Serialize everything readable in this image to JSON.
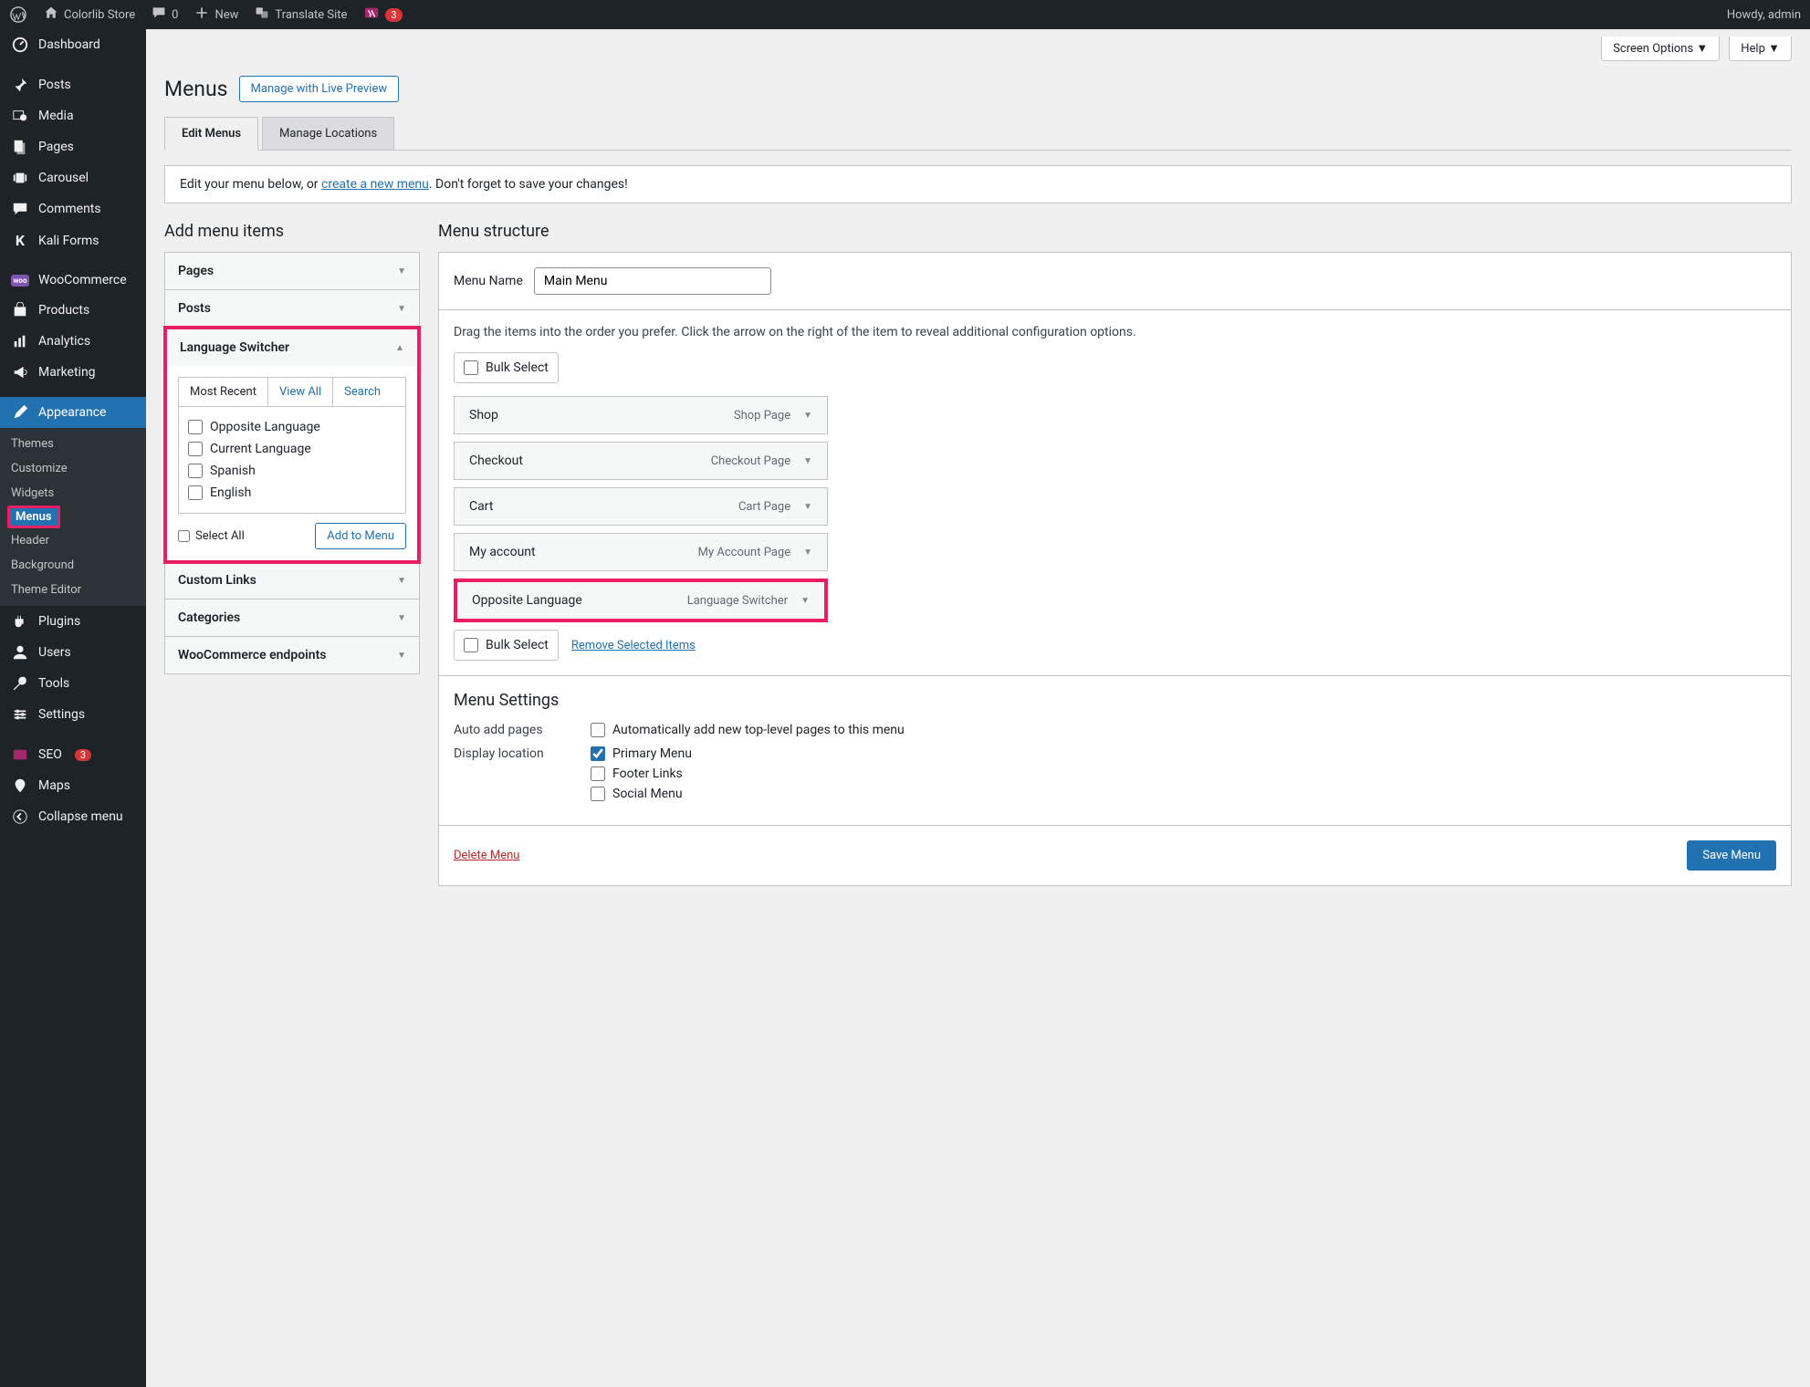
{
  "topbar": {
    "site_name": "Colorlib Store",
    "comments_count": "0",
    "new_label": "New",
    "translate_label": "Translate Site",
    "yoast_count": "3",
    "greeting": "Howdy, admin"
  },
  "sidebar": {
    "items": [
      {
        "label": "Dashboard",
        "icon": "dashboard"
      },
      {
        "label": "Posts",
        "icon": "pin"
      },
      {
        "label": "Media",
        "icon": "media"
      },
      {
        "label": "Pages",
        "icon": "pages"
      },
      {
        "label": "Carousel",
        "icon": "carousel"
      },
      {
        "label": "Comments",
        "icon": "comment"
      },
      {
        "label": "Kali Forms",
        "icon": "kali"
      },
      {
        "label": "WooCommerce",
        "icon": "woo"
      },
      {
        "label": "Products",
        "icon": "products"
      },
      {
        "label": "Analytics",
        "icon": "analytics"
      },
      {
        "label": "Marketing",
        "icon": "marketing"
      },
      {
        "label": "Appearance",
        "icon": "appearance",
        "active": true
      },
      {
        "label": "Plugins",
        "icon": "plugins"
      },
      {
        "label": "Users",
        "icon": "users"
      },
      {
        "label": "Tools",
        "icon": "tools"
      },
      {
        "label": "Settings",
        "icon": "settings"
      },
      {
        "label": "SEO",
        "icon": "seo",
        "badge": "3"
      },
      {
        "label": "Maps",
        "icon": "maps"
      },
      {
        "label": "Collapse menu",
        "icon": "collapse"
      }
    ],
    "sub_appearance": {
      "items": [
        "Themes",
        "Customize",
        "Widgets",
        "Menus",
        "Header",
        "Background",
        "Theme Editor"
      ],
      "current": "Menus"
    }
  },
  "screen_meta": {
    "screen_options": "Screen Options",
    "help": "Help"
  },
  "page": {
    "title": "Menus",
    "action": "Manage with Live Preview"
  },
  "tabs": {
    "edit": "Edit Menus",
    "locations": "Manage Locations"
  },
  "info": {
    "prefix": "Edit your menu below, or ",
    "link": "create a new menu",
    "suffix": ". Don't forget to save your changes!"
  },
  "columns": {
    "left_heading": "Add menu items",
    "right_heading": "Menu structure"
  },
  "accordion": {
    "pages": "Pages",
    "posts": "Posts",
    "language_switcher": {
      "title": "Language Switcher",
      "tab_recent": "Most Recent",
      "tab_all": "View All",
      "tab_search": "Search",
      "items": [
        "Opposite Language",
        "Current Language",
        "Spanish",
        "English"
      ],
      "select_all": "Select All",
      "add_btn": "Add to Menu"
    },
    "custom_links": "Custom Links",
    "categories": "Categories",
    "woo_endpoints": "WooCommerce endpoints"
  },
  "menu": {
    "name_label": "Menu Name",
    "name_value": "Main Menu",
    "hint": "Drag the items into the order you prefer. Click the arrow on the right of the item to reveal additional configuration options.",
    "bulk_select": "Bulk Select",
    "items": [
      {
        "title": "Shop",
        "type": "Shop Page"
      },
      {
        "title": "Checkout",
        "type": "Checkout Page"
      },
      {
        "title": "Cart",
        "type": "Cart Page"
      },
      {
        "title": "My account",
        "type": "My Account Page"
      },
      {
        "title": "Opposite Language",
        "type": "Language Switcher",
        "highlighted": true
      }
    ],
    "remove_selected": "Remove Selected Items"
  },
  "settings": {
    "title": "Menu Settings",
    "auto_add_label": "Auto add pages",
    "auto_add_option": "Automatically add new top-level pages to this menu",
    "display_label": "Display location",
    "locations": [
      {
        "label": "Primary Menu",
        "checked": true
      },
      {
        "label": "Footer Links",
        "checked": false
      },
      {
        "label": "Social Menu",
        "checked": false
      }
    ]
  },
  "footer": {
    "delete": "Delete Menu",
    "save": "Save Menu"
  }
}
